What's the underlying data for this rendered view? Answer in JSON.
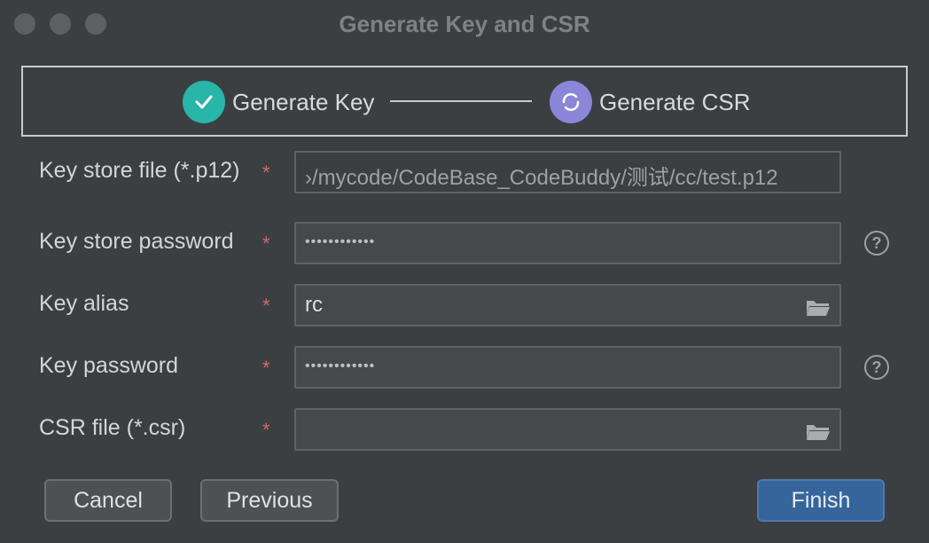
{
  "window": {
    "title": "Generate Key and CSR"
  },
  "stepper": {
    "steps": [
      {
        "label": "Generate Key",
        "status": "completed",
        "icon": "check-icon",
        "color": "#29b5a8"
      },
      {
        "label": "Generate CSR",
        "status": "in-progress",
        "icon": "refresh-icon",
        "color": "#8a86d8"
      }
    ]
  },
  "form": {
    "required_mark": "*",
    "fields": [
      {
        "label": "Key store file (*.p12)",
        "value": "›/mycode/CodeBase_CodeBuddy/测试/cc/test.p12"
      },
      {
        "label": "Key store password",
        "value": "••••••••••••",
        "help": "?"
      },
      {
        "label": "Key alias",
        "value": "rc",
        "icon": "folder-icon"
      },
      {
        "label": "Key password",
        "value": "••••••••••••",
        "help": "?"
      },
      {
        "label": "CSR file (*.csr)",
        "value": "",
        "icon": "folder-icon"
      }
    ]
  },
  "buttons": {
    "cancel": "Cancel",
    "previous": "Previous",
    "finish": "Finish"
  },
  "colors": {
    "required": "#d06a6a",
    "accent": "#36659c"
  }
}
